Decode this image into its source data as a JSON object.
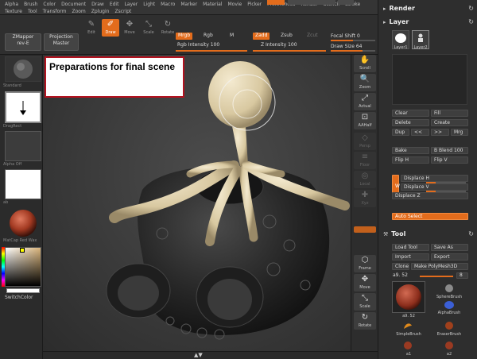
{
  "menu": {
    "row1": [
      "Alpha",
      "Brush",
      "Color",
      "Document",
      "Draw",
      "Edit",
      "Layer",
      "Light",
      "Macro",
      "Marker",
      "Material",
      "Movie",
      "Picker",
      "Preferences",
      "Render",
      "Stencil",
      "Stroke"
    ],
    "row2": [
      "Texture",
      "Tool",
      "Transform",
      "Zoom",
      "Zplugin",
      "Zscript"
    ]
  },
  "toolbar": {
    "zmapper": "ZMapper",
    "zmapper_sub": "rev-E",
    "projection": "Projection",
    "projection_sub": "Master",
    "tools": [
      {
        "label": "Edit",
        "active": false
      },
      {
        "label": "Draw",
        "active": true
      },
      {
        "label": "Move",
        "active": false
      },
      {
        "label": "Scale",
        "active": false
      },
      {
        "label": "Rotate",
        "active": false
      }
    ],
    "mrgb": "Mrgb",
    "rgb": "Rgb",
    "m": "M",
    "zadd": "Zadd",
    "zsub": "Zsub",
    "zcut": "Zcut",
    "rgb_intensity_label": "Rgb Intensity",
    "rgb_intensity_value": "100",
    "z_intensity_label": "Z Intensity",
    "z_intensity_value": "100",
    "focal_shift_label": "Focal Shift",
    "focal_shift_value": "0",
    "draw_size_label": "Draw Size",
    "draw_size_value": "64"
  },
  "left_tray": {
    "brush_caption": "Standard",
    "stroke_caption": "DragRect",
    "alpha_caption": "Alpha Off",
    "texture_caption": "ab",
    "material_caption": "MatCap Red Wax",
    "switch_color": "SwitchColor"
  },
  "canvas": {
    "note": "Preparations for final scene"
  },
  "shelf": {
    "buttons": [
      {
        "label": "Scroll",
        "glyph": "✋",
        "dim": false
      },
      {
        "label": "Zoom",
        "glyph": "🔍",
        "dim": false
      },
      {
        "label": "Actual",
        "glyph": "⤢",
        "dim": false
      },
      {
        "label": "AAHalf",
        "glyph": "⊡",
        "dim": false
      },
      {
        "label": "Persp",
        "glyph": "◇",
        "dim": true
      },
      {
        "label": "Floor",
        "glyph": "≡",
        "dim": true
      },
      {
        "label": "Local",
        "glyph": "◎",
        "dim": true
      },
      {
        "label": "Xyz",
        "glyph": "✚",
        "dim": true
      },
      {
        "label": "Frame",
        "glyph": "⬡",
        "dim": false
      },
      {
        "label": "Move",
        "glyph": "✥",
        "dim": false
      },
      {
        "label": "Scale",
        "glyph": "⤡",
        "dim": false
      },
      {
        "label": "Rotate",
        "glyph": "↻",
        "dim": false
      }
    ]
  },
  "panel": {
    "render_title": "Render",
    "layer_title": "Layer",
    "layers": [
      "Layer1",
      "Layer2"
    ],
    "clear": "Clear",
    "fill": "Fill",
    "delete": "Delete",
    "create": "Create",
    "dup": "Dup",
    "prev": "<<",
    "next": ">>",
    "mrg": "Mrg",
    "bake": "Bake",
    "b_blend_label": "B Blend",
    "b_blend_value": "100",
    "flip_h": "Flip H",
    "flip_v": "Flip V",
    "w": "W",
    "displace_h": "Displace H",
    "displace_v": "Displace V",
    "displace_z": "Displace Z",
    "auto_select": "Auto Select",
    "tool_title": "Tool",
    "load_tool": "Load Tool",
    "save_as": "Save As",
    "import": "Import",
    "export": "Export",
    "clone": "Clone",
    "make_polymesh": "Make PolyMesh3D",
    "tool_name": "a9. 52",
    "tool_count": "8",
    "brushes": [
      "SphereBrush",
      "AlphaBrush",
      "SimpleBrush",
      "EraserBrush",
      "a1",
      "a2"
    ]
  },
  "colors": {
    "accent": "#e36c1c",
    "note_border": "#b3121f",
    "clay": "#ddd1b0"
  }
}
